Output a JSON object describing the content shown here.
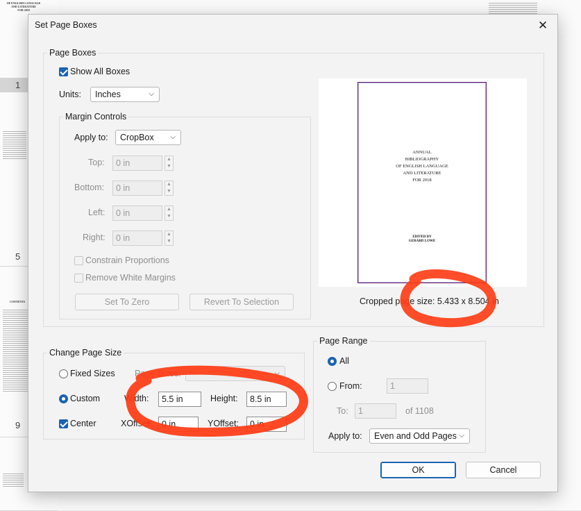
{
  "background": {
    "thumbnails": [
      {
        "label": "1",
        "selected": true
      },
      {
        "label": "5",
        "selected": false
      },
      {
        "label": "9",
        "selected": false
      }
    ],
    "thumb_snippets": {
      "top_left": "OF ENGLISH LANGUAGE\nAND LITERATURE\nFOR 2018",
      "contents": "CONTENTS"
    }
  },
  "dialog": {
    "title": "Set Page Boxes",
    "close_icon": "close-icon"
  },
  "page_boxes": {
    "group_title": "Page Boxes",
    "show_all_boxes": {
      "label": "Show All Boxes",
      "checked": true
    },
    "units_label": "Units:",
    "units_value": "Inches",
    "margin_controls": {
      "group_title": "Margin Controls",
      "apply_to_label": "Apply to:",
      "apply_to_value": "CropBox",
      "top_label": "Top:",
      "top_value": "0 in",
      "bottom_label": "Bottom:",
      "bottom_value": "0 in",
      "left_label": "Left:",
      "left_value": "0 in",
      "right_label": "Right:",
      "right_value": "0 in",
      "constrain_label": "Constrain Proportions",
      "remove_white_label": "Remove White Margins",
      "set_to_zero": "Set To Zero",
      "revert_to_selection": "Revert To Selection"
    },
    "preview": {
      "page_title": "ANNUAL\nBIBLIOGRAPHY\nOF ENGLISH LANGUAGE\nAND LITERATURE\nFOR 2018",
      "page_author": "EDITED BY\nGERARD LOWE",
      "cropped_size_text": "Cropped page size: 5.433 x 8.504 in"
    }
  },
  "change_page_size": {
    "group_title": "Change Page Size",
    "fixed_sizes_label": "Fixed Sizes",
    "fixed_sizes_selected": false,
    "page_sizes_label": "Page Sizes:",
    "custom_label": "Custom",
    "custom_selected": true,
    "width_label": "Width:",
    "width_value": "5.5 in",
    "height_label": "Height:",
    "height_value": "8.5 in",
    "center_label": "Center",
    "center_checked": true,
    "xoffset_label": "XOffset:",
    "xoffset_value": "0 in",
    "yoffset_label": "YOffset:",
    "yoffset_value": "0 in"
  },
  "page_range": {
    "group_title": "Page Range",
    "all_label": "All",
    "all_selected": true,
    "from_label": "From:",
    "from_value": "1",
    "to_label": "To:",
    "to_value": "1",
    "of_total": "of 1108",
    "apply_to_label": "Apply to:",
    "apply_to_value": "Even and Odd Pages"
  },
  "buttons": {
    "ok": "OK",
    "cancel": "Cancel"
  },
  "annotation": {
    "color": "#ff3b12",
    "description_icon": "hand-drawn-circle-icon"
  }
}
